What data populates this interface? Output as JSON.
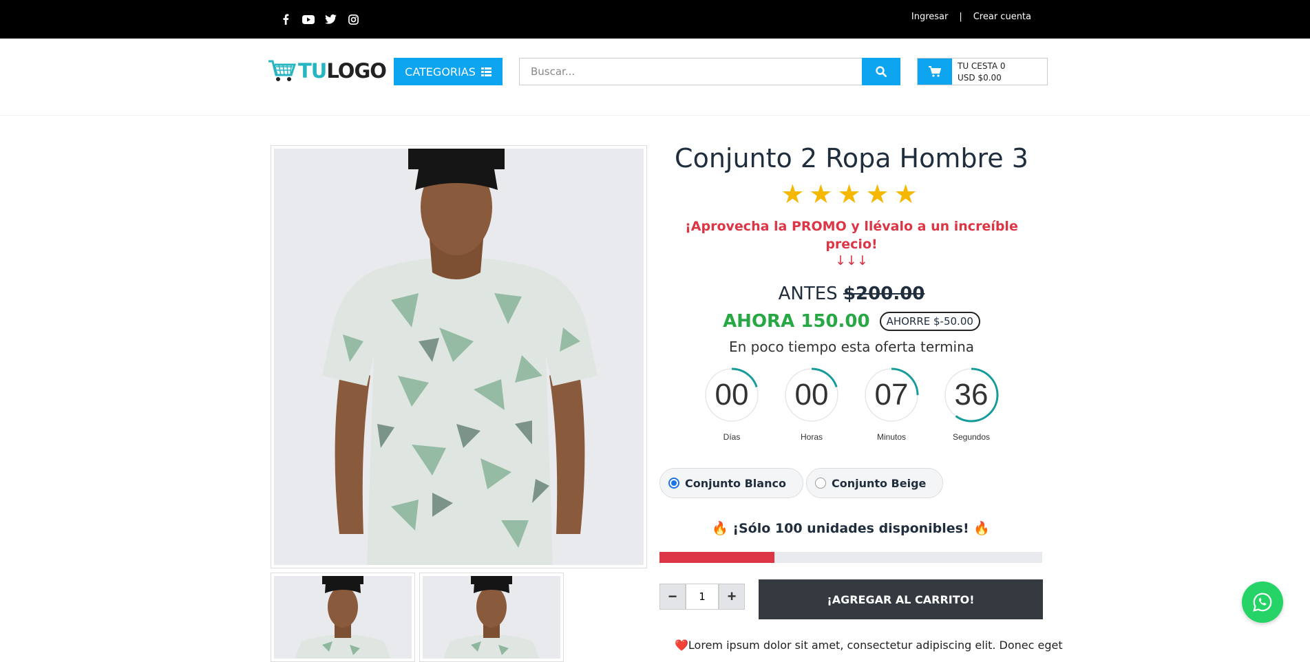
{
  "topbar": {
    "social": [
      "facebook-icon",
      "youtube-icon",
      "twitter-icon",
      "instagram-icon"
    ],
    "login": "Ingresar",
    "separator": "|",
    "register": "Crear cuenta"
  },
  "header": {
    "logo_tu": "TU",
    "logo_logo": "LOGO",
    "categories": "CATEGORIAS",
    "search_placeholder": "Buscar...",
    "cart_line1": "TU CESTA 0",
    "cart_line2": "USD $0.00"
  },
  "product": {
    "title": "Conjunto 2 Ropa Hombre 3",
    "stars": "★★★★★",
    "rating": 5,
    "promo": "¡Aprovecha la PROMO y llévalo a un increíble precio!",
    "arrows": "↓↓↓",
    "antes_label": "ANTES",
    "antes_price": "$200.00",
    "ahora": "AHORA 150.00",
    "ahorre": "AHORRE $-50.00",
    "oferta": "En poco tiempo esta oferta termina"
  },
  "countdown": [
    {
      "value": "00",
      "label": "Días",
      "fraction": 0.2
    },
    {
      "value": "00",
      "label": "Horas",
      "fraction": 0.2
    },
    {
      "value": "07",
      "label": "Minutos",
      "fraction": 0.25
    },
    {
      "value": "36",
      "label": "Segundos",
      "fraction": 0.6
    }
  ],
  "variants": [
    {
      "label": "Conjunto Blanco",
      "selected": true
    },
    {
      "label": "Conjunto Beige",
      "selected": false
    }
  ],
  "stock": {
    "text": "¡Sólo 100 unidades disponibles!",
    "progress": 0.3
  },
  "quantity": {
    "minus": "−",
    "value": "1",
    "plus": "+"
  },
  "add_to_cart": "¡AGREGAR AL CARRITO!",
  "description": "Lorem ipsum dolor sit amet, consectetur adipiscing elit. Donec eget",
  "colors": {
    "accent": "#0ea5f0",
    "red": "#dc3545",
    "green": "#28a745",
    "teal": "#169b9b",
    "whatsapp": "#25d366"
  }
}
